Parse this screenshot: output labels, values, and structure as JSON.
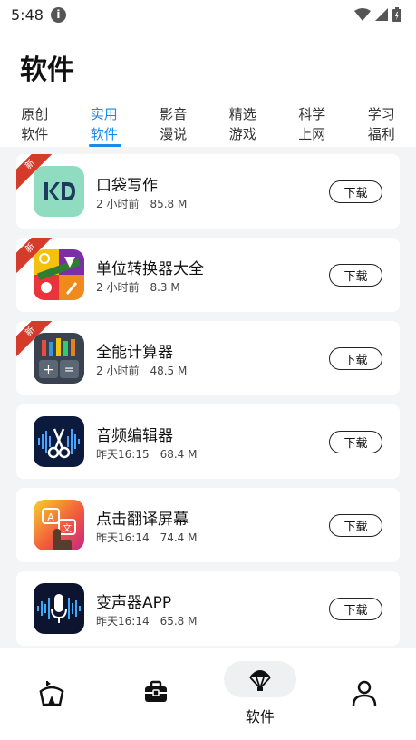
{
  "status_bar": {
    "time": "5:48",
    "info_icon": "info-icon",
    "wifi_icon": "wifi-icon",
    "signal_icon": "signal-icon",
    "battery_icon": "battery-icon"
  },
  "page": {
    "title": "软件"
  },
  "tabs": [
    {
      "line1": "原创",
      "line2": "软件",
      "active": false
    },
    {
      "line1": "实用",
      "line2": "软件",
      "active": true
    },
    {
      "line1": "影音",
      "line2": "漫说",
      "active": false
    },
    {
      "line1": "精选",
      "line2": "游戏",
      "active": false
    },
    {
      "line1": "科学",
      "line2": "上网",
      "active": false
    },
    {
      "line1": "学习",
      "line2": "福利",
      "active": false
    }
  ],
  "new_badge_label": "新",
  "apps": [
    {
      "name": "口袋写作",
      "time": "2 小时前",
      "size": "85.8 M",
      "is_new": true,
      "icon": "kd-logo-icon",
      "download_label": "下载"
    },
    {
      "name": "单位转换器大全",
      "time": "2 小时前",
      "size": "8.3 M",
      "is_new": true,
      "icon": "unit-converter-icon",
      "download_label": "下载"
    },
    {
      "name": "全能计算器",
      "time": "2 小时前",
      "size": "48.5 M",
      "is_new": true,
      "icon": "calculator-icon",
      "download_label": "下载"
    },
    {
      "name": "音频编辑器",
      "time": "昨天16:15",
      "size": "68.4 M",
      "is_new": false,
      "icon": "audio-scissors-icon",
      "download_label": "下载"
    },
    {
      "name": "点击翻译屏幕",
      "time": "昨天16:14",
      "size": "74.4 M",
      "is_new": false,
      "icon": "translate-tap-icon",
      "download_label": "下载"
    },
    {
      "name": "变声器APP",
      "time": "昨天16:14",
      "size": "65.8 M",
      "is_new": false,
      "icon": "voice-mic-icon",
      "download_label": "下载"
    }
  ],
  "bottom_nav": [
    {
      "icon": "circus-tent-icon",
      "label": "",
      "active": false
    },
    {
      "icon": "briefcase-icon",
      "label": "",
      "active": false
    },
    {
      "icon": "parachute-icon",
      "label": "软件",
      "active": true
    },
    {
      "icon": "person-icon",
      "label": "",
      "active": false
    }
  ],
  "colors": {
    "accent": "#1a8ae6",
    "badge": "#d43b2a",
    "list_bg": "#f3f4f6"
  }
}
